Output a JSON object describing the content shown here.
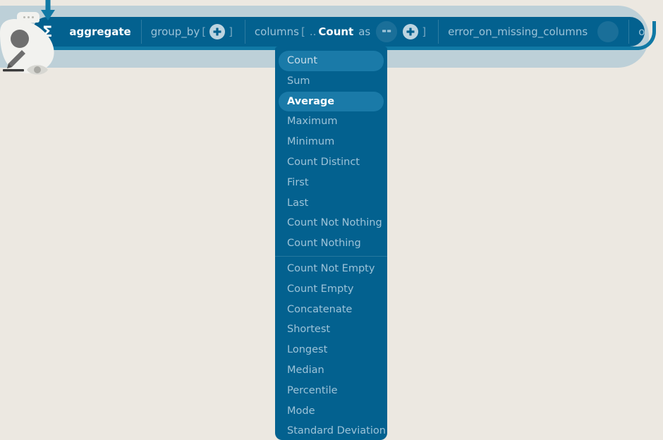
{
  "canvas": {
    "background_color": "#ece8e1"
  },
  "node": {
    "shell_color": "#bdd0d8",
    "bar_color": "#03618f",
    "accent_color": "#1179a5",
    "incoming_arrow": "down-arrow",
    "title": "aggregate",
    "title_icon": "sigma-icon",
    "segments": [
      {
        "name": "group_by",
        "label": "group_by",
        "open_bracket": "[",
        "close_bracket": "]",
        "control": "add-icon"
      },
      {
        "name": "columns",
        "label": "columns",
        "open_bracket": "[",
        "ellipsis": "..",
        "value": "Count",
        "as_label": "as",
        "close_bracket": "]",
        "control": "add-icon",
        "text_widget_icon": "quote-icon"
      },
      {
        "name": "error_on_missing_columns",
        "label": "error_on_missing_columns"
      },
      {
        "name": "on_problems",
        "label": "on_problems"
      }
    ]
  },
  "node_widget": {
    "handle_icon": "drag-handle-icon",
    "circle_icon": "node-handle-icon",
    "edit_icon": "pencil-icon",
    "preview_icon": "eye-icon"
  },
  "dropdown": {
    "selected": "Count",
    "hovered": "Average",
    "background_color": "#03618f",
    "highlight_color": "#1a7aa8",
    "items": [
      {
        "label": "Count",
        "state": "current"
      },
      {
        "label": "Sum",
        "state": "normal"
      },
      {
        "label": "Average",
        "state": "hovered"
      },
      {
        "label": "Maximum",
        "state": "normal"
      },
      {
        "label": "Minimum",
        "state": "normal"
      },
      {
        "label": "Count Distinct",
        "state": "normal"
      },
      {
        "label": "First",
        "state": "normal"
      },
      {
        "label": "Last",
        "state": "normal"
      },
      {
        "label": "Count Not Nothing",
        "state": "normal"
      },
      {
        "label": "Count Nothing",
        "state": "normal",
        "divider_after": true
      },
      {
        "label": "Count Not Empty",
        "state": "normal"
      },
      {
        "label": "Count Empty",
        "state": "normal"
      },
      {
        "label": "Concatenate",
        "state": "normal"
      },
      {
        "label": "Shortest",
        "state": "normal"
      },
      {
        "label": "Longest",
        "state": "normal"
      },
      {
        "label": "Median",
        "state": "normal"
      },
      {
        "label": "Percentile",
        "state": "normal"
      },
      {
        "label": "Mode",
        "state": "normal"
      },
      {
        "label": "Standard Deviation",
        "state": "normal"
      }
    ]
  }
}
